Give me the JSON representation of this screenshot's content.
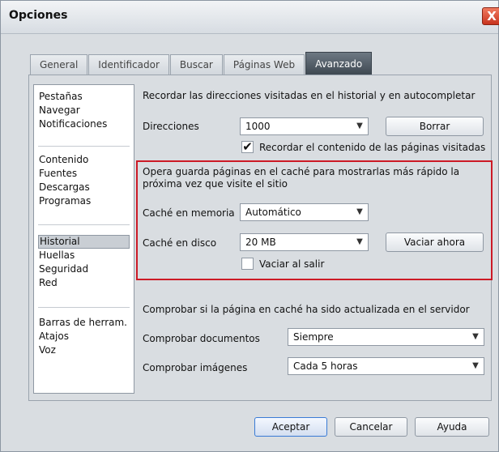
{
  "window": {
    "title": "Opciones",
    "close_glyph": "X"
  },
  "tabs": [
    {
      "label": "General"
    },
    {
      "label": "Identificador"
    },
    {
      "label": "Buscar"
    },
    {
      "label": "Páginas Web"
    },
    {
      "label": "Avanzado",
      "active": true
    }
  ],
  "sidebar": {
    "groups": [
      [
        "Pestañas",
        "Navegar",
        "Notificaciones"
      ],
      [
        "Contenido",
        "Fuentes",
        "Descargas",
        "Programas"
      ],
      [
        "Historial",
        "Huellas",
        "Seguridad",
        "Red"
      ],
      [
        "Barras de herram.",
        "Atajos",
        "Voz"
      ]
    ],
    "selected": "Historial"
  },
  "history": {
    "remember_label": "Recordar las direcciones visitadas en el historial y en autocompletar",
    "addresses_label": "Direcciones",
    "addresses_value": "1000",
    "clear_button": "Borrar",
    "remember_content_checked": true,
    "remember_content_label": "Recordar el contenido de las páginas visitadas"
  },
  "cache": {
    "description": "Opera guarda páginas en el caché para mostrarlas más rápido la próxima vez que visite el sitio",
    "memory_label": "Caché en memoria",
    "memory_value": "Automático",
    "disk_label": "Caché en disco",
    "disk_value": "20 MB",
    "empty_now_button": "Vaciar ahora",
    "empty_on_exit_checked": false,
    "empty_on_exit_label": "Vaciar al salir"
  },
  "check": {
    "heading": "Comprobar si la página en caché ha sido actualizada en el servidor",
    "documents_label": "Comprobar documentos",
    "documents_value": "Siempre",
    "images_label": "Comprobar imágenes",
    "images_value": "Cada 5 horas"
  },
  "footer": {
    "ok": "Aceptar",
    "cancel": "Cancelar",
    "help": "Ayuda"
  },
  "glyphs": {
    "dropdown_arrow": "▼",
    "checkmark": "✔"
  },
  "colors": {
    "active_tab": "#4a555f",
    "highlight_border": "#cc1a26",
    "close_button": "#d9432a"
  }
}
